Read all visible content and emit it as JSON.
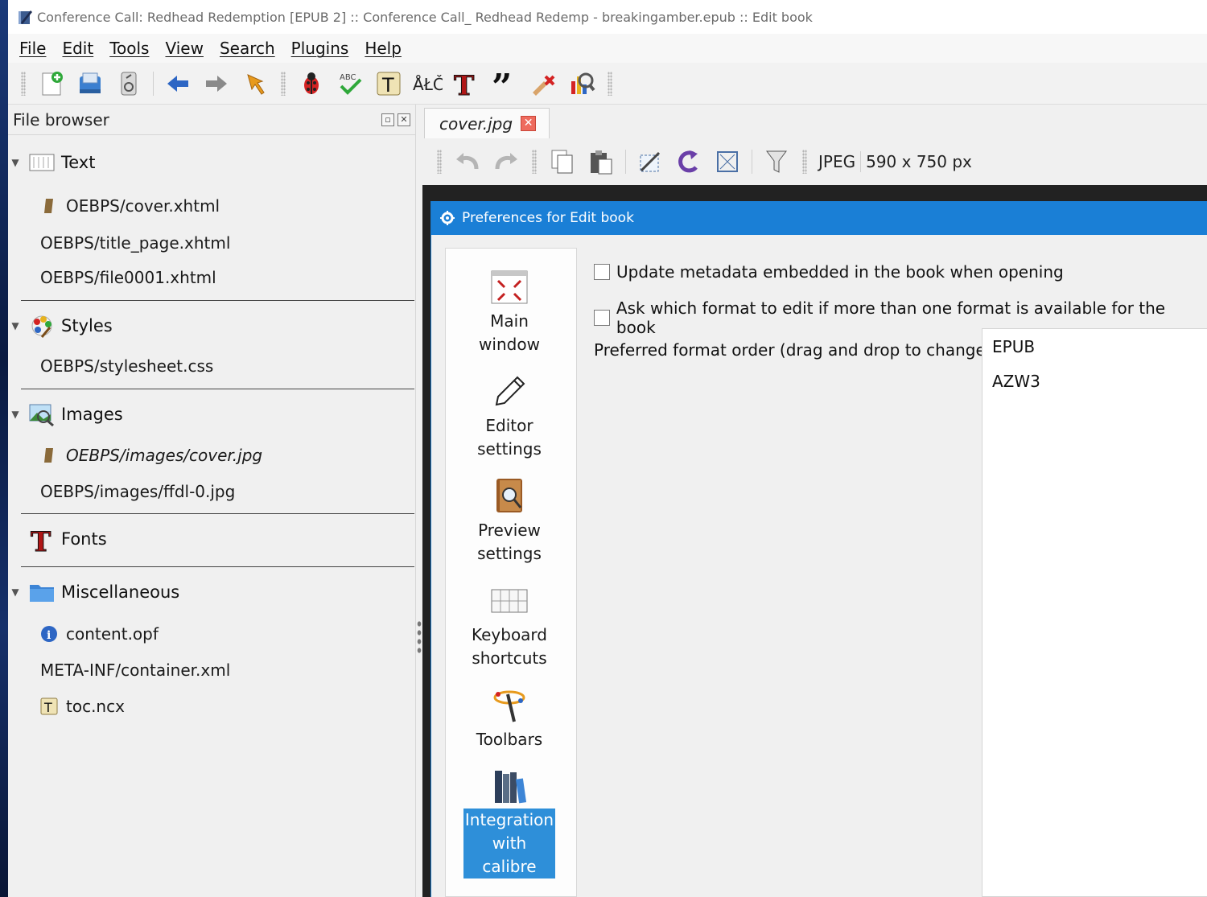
{
  "window": {
    "title": "Conference Call: Redhead Redemption [EPUB 2] :: Conference Call_ Redhead Redemp - breakingamber.epub :: Edit book"
  },
  "menubar": {
    "items": [
      "File",
      "Edit",
      "Tools",
      "View",
      "Search",
      "Plugins",
      "Help"
    ]
  },
  "toolbar": {
    "icons": [
      "new-file-icon",
      "save-icon",
      "checkpoint-icon",
      "back-icon",
      "forward-icon",
      "pin-icon",
      "bug-icon",
      "spellcheck-icon",
      "text-icon",
      "charmap-icon",
      "fonts-icon",
      "quote-icon",
      "remove-unused-icon",
      "reports-icon"
    ]
  },
  "file_browser": {
    "title": "File browser",
    "sections": [
      {
        "label": "Text",
        "icon": "text-files-icon",
        "files": [
          {
            "name": "OEBPS/cover.xhtml",
            "icon": "cover-marker-icon",
            "italic": false
          },
          {
            "name": "OEBPS/title_page.xhtml",
            "icon": "",
            "italic": false
          },
          {
            "name": "OEBPS/file0001.xhtml",
            "icon": "",
            "italic": false
          }
        ]
      },
      {
        "label": "Styles",
        "icon": "styles-icon",
        "files": [
          {
            "name": "OEBPS/stylesheet.css",
            "icon": "",
            "italic": false
          }
        ]
      },
      {
        "label": "Images",
        "icon": "images-icon",
        "files": [
          {
            "name": "OEBPS/images/cover.jpg",
            "icon": "cover-marker-icon",
            "italic": true
          },
          {
            "name": "OEBPS/images/ffdl-0.jpg",
            "icon": "",
            "italic": false
          }
        ]
      },
      {
        "label": "Fonts",
        "icon": "fonts-section-icon",
        "files": []
      },
      {
        "label": "Miscellaneous",
        "icon": "folder-icon",
        "files": [
          {
            "name": "content.opf",
            "icon": "info-icon",
            "italic": false
          },
          {
            "name": "META-INF/container.xml",
            "icon": "",
            "italic": false
          },
          {
            "name": "toc.ncx",
            "icon": "toc-icon",
            "italic": false
          }
        ]
      }
    ]
  },
  "editor": {
    "tab_label": "cover.jpg",
    "image_format": "JPEG",
    "image_size": "590 x 750 px"
  },
  "preferences": {
    "title": "Preferences for Edit book",
    "categories": [
      {
        "label": "Main window",
        "line1": "Main",
        "line2": "window",
        "line3": "",
        "icon": "main-window-icon"
      },
      {
        "label": "Editor settings",
        "line1": "Editor",
        "line2": "settings",
        "line3": "",
        "icon": "pencil-icon"
      },
      {
        "label": "Preview settings",
        "line1": "Preview",
        "line2": "settings",
        "line3": "",
        "icon": "preview-icon"
      },
      {
        "label": "Keyboard shortcuts",
        "line1": "Keyboard",
        "line2": "shortcuts",
        "line3": "",
        "icon": "keyboard-icon"
      },
      {
        "label": "Toolbars",
        "line1": "Toolbars",
        "line2": "",
        "line3": "",
        "icon": "toolbars-icon"
      },
      {
        "label": "Integration with calibre",
        "line1": "Integration",
        "line2": "with",
        "line3": "calibre",
        "icon": "library-icon",
        "selected": true
      }
    ],
    "options": {
      "update_metadata": {
        "label": "Update metadata embedded in the book when opening",
        "checked": false
      },
      "ask_format": {
        "label": "Ask which format to edit if more than one format is available for the book",
        "checked": false
      }
    },
    "preferred_order_label": "Preferred format order (drag and drop to change)",
    "formats": [
      "EPUB",
      "AZW3"
    ]
  },
  "colors": {
    "dialog_title_bg": "#1a7fd6",
    "selection_bg": "#2e8fd9",
    "close_tab": "#ee6b5e"
  }
}
